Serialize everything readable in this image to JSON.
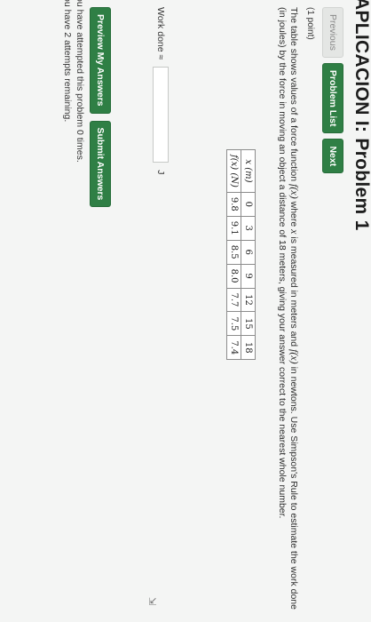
{
  "page": {
    "title": "APLICACION I: Problem 1"
  },
  "nav": {
    "previous": "Previous",
    "problem_list": "Problem List",
    "next": "Next"
  },
  "problem": {
    "points": "(1 point)",
    "statement_1": "The table shows values of a force function ",
    "fx": "f(x)",
    "statement_2": " where ",
    "x": "x",
    "statement_3": " is measured in meters and ",
    "statement_4": " in newtons. Use Simpson's Rule to estimate the work done (in joules) by the force in moving an object a distance of 18 meters, giving your answer correct to the nearest whole number.",
    "table": {
      "row1_header": "x (m)",
      "row2_header": "f(x) (N)",
      "x_values": [
        "0",
        "3",
        "6",
        "9",
        "12",
        "15",
        "18"
      ],
      "f_values": [
        "9.8",
        "9.1",
        "8.5",
        "8.0",
        "7.7",
        "7.5",
        "7.4"
      ]
    },
    "work_label": "Work done ≈",
    "answer_value": "",
    "unit": "J",
    "resize_glyph": "⇲"
  },
  "actions": {
    "preview": "Preview My Answers",
    "submit": "Submit Answers"
  },
  "messages": {
    "attempted": "ou have attempted this problem 0 times.",
    "remaining": "ou have 2 attempts remaining."
  }
}
